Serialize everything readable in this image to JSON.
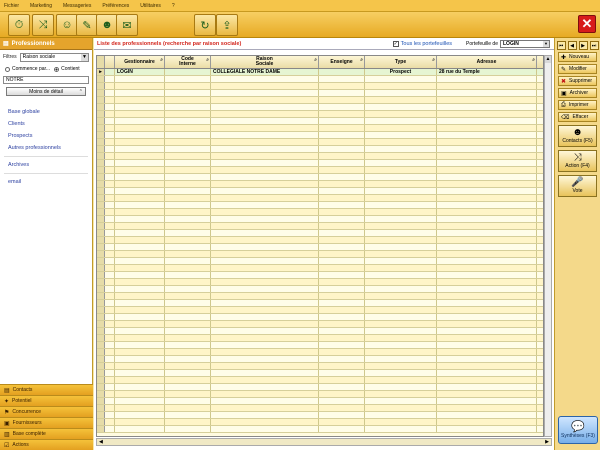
{
  "menu": [
    "Fichier",
    "Marketing",
    "Messageries",
    "Préférences",
    "Utilitaires",
    "?"
  ],
  "sidebar": {
    "header": "Professionnels",
    "filter_label": "Filtres",
    "filter_value": "Raison sociale",
    "radio_begins": "Commence par...",
    "radio_contains": "Contient",
    "search_value": "NOTRE",
    "detail_button": "Moins de détail",
    "nav": [
      "Base globale",
      "Clients",
      "Prospects",
      "Autres professionnels",
      "Archives",
      "email"
    ],
    "accordion": [
      "Contacts",
      "Potentiel",
      "Concurrence",
      "Fournisseurs",
      "Base complète",
      "Actions"
    ]
  },
  "main": {
    "title": "Liste des professionnels (recherche par raison sociale)",
    "all_portfolios_label": "Tous les portefeuilles",
    "portfolio_label": "Portefeuille de",
    "portfolio_value": "LOGIN",
    "columns": [
      "Gestionnaire",
      "Code\nInterne",
      "Raison\nSociale",
      "Enseigne",
      "Type",
      "Adresse"
    ],
    "rows": [
      [
        "LOGIN",
        "",
        "COLLEGIALE NOTRE DAME",
        "",
        "Prospect",
        "28 rue du Temple"
      ]
    ]
  },
  "right": {
    "actions": [
      "Nouveau",
      "Modifier",
      "Supprimer",
      "Archiver",
      "Imprimer",
      "Effacer"
    ],
    "contacts_button": "Contacts (F5)",
    "action_button": "Action (F4)",
    "vote_button": "Vote",
    "synthese_button": "Synthèses (F3)"
  },
  "colors": {
    "accent": "#e5a42c",
    "title_red": "#d3261d",
    "link_blue": "#2b3fa0"
  }
}
